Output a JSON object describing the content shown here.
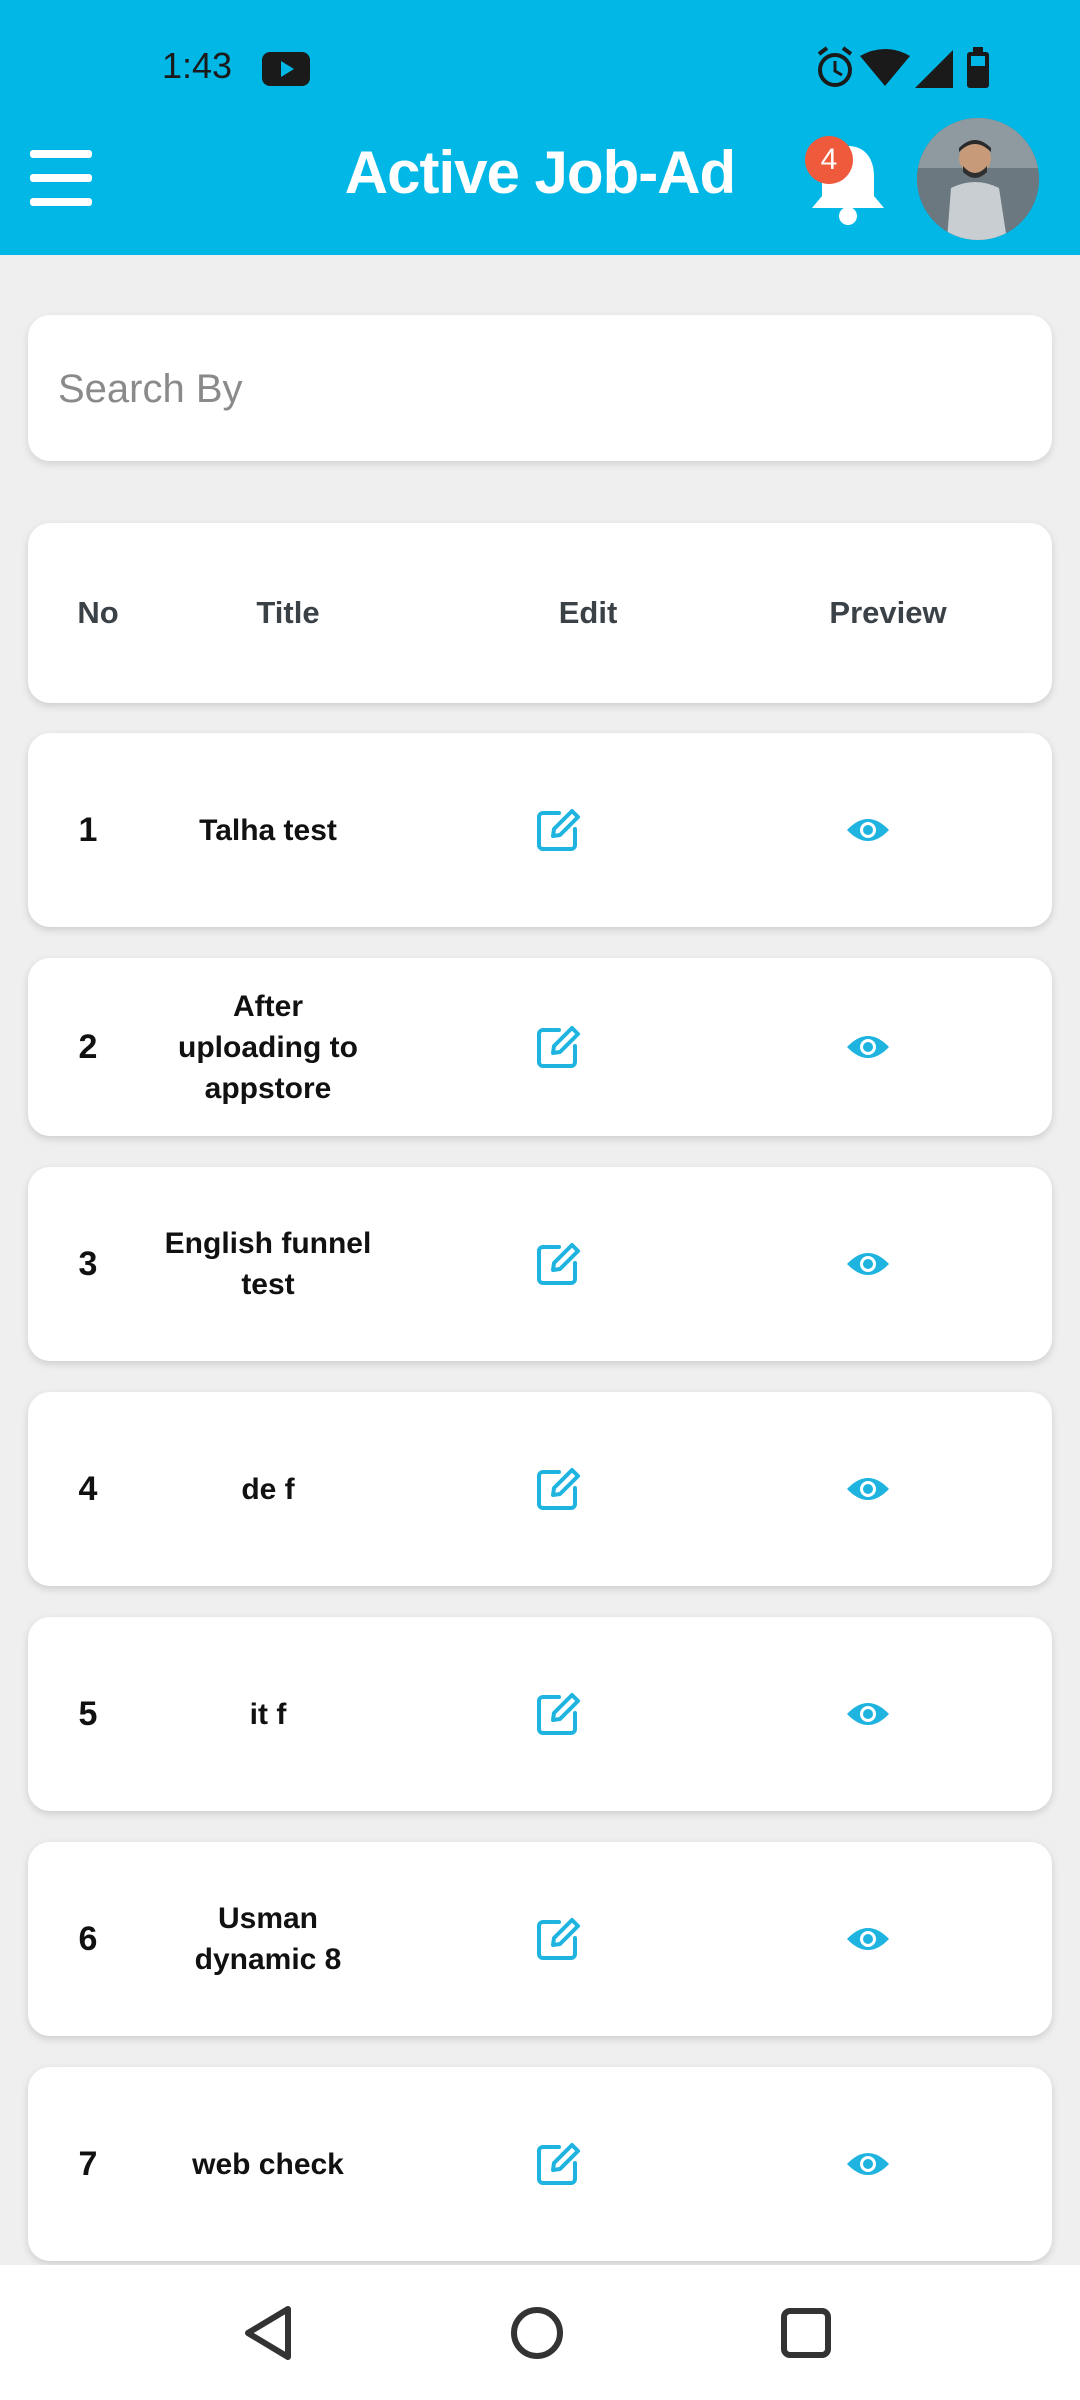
{
  "status_bar": {
    "time": "1:43"
  },
  "header": {
    "title": "Active Job-Ad",
    "notification_count": "4"
  },
  "search": {
    "placeholder": "Search By",
    "value": ""
  },
  "table": {
    "headers": {
      "no": "No",
      "title": "Title",
      "edit": "Edit",
      "preview": "Preview"
    },
    "rows": [
      {
        "no": "1",
        "title": "Talha test"
      },
      {
        "no": "2",
        "title": "After uploading to appstore"
      },
      {
        "no": "3",
        "title": "English funnel test"
      },
      {
        "no": "4",
        "title": "de f"
      },
      {
        "no": "5",
        "title": "it f"
      },
      {
        "no": "6",
        "title": "Usman dynamic 8"
      },
      {
        "no": "7",
        "title": "web check"
      }
    ]
  },
  "icons": {
    "menu": "hamburger-menu-icon",
    "notifications": "bell-icon",
    "edit": "edit-pencil-icon",
    "preview": "eye-icon",
    "nav_back": "triangle-back-icon",
    "nav_home": "circle-home-icon",
    "nav_recents": "square-recents-icon"
  },
  "colors": {
    "primary": "#00b7e6",
    "badge": "#f05a3c",
    "icon_accent": "#1eb4df",
    "background": "#efefef"
  }
}
